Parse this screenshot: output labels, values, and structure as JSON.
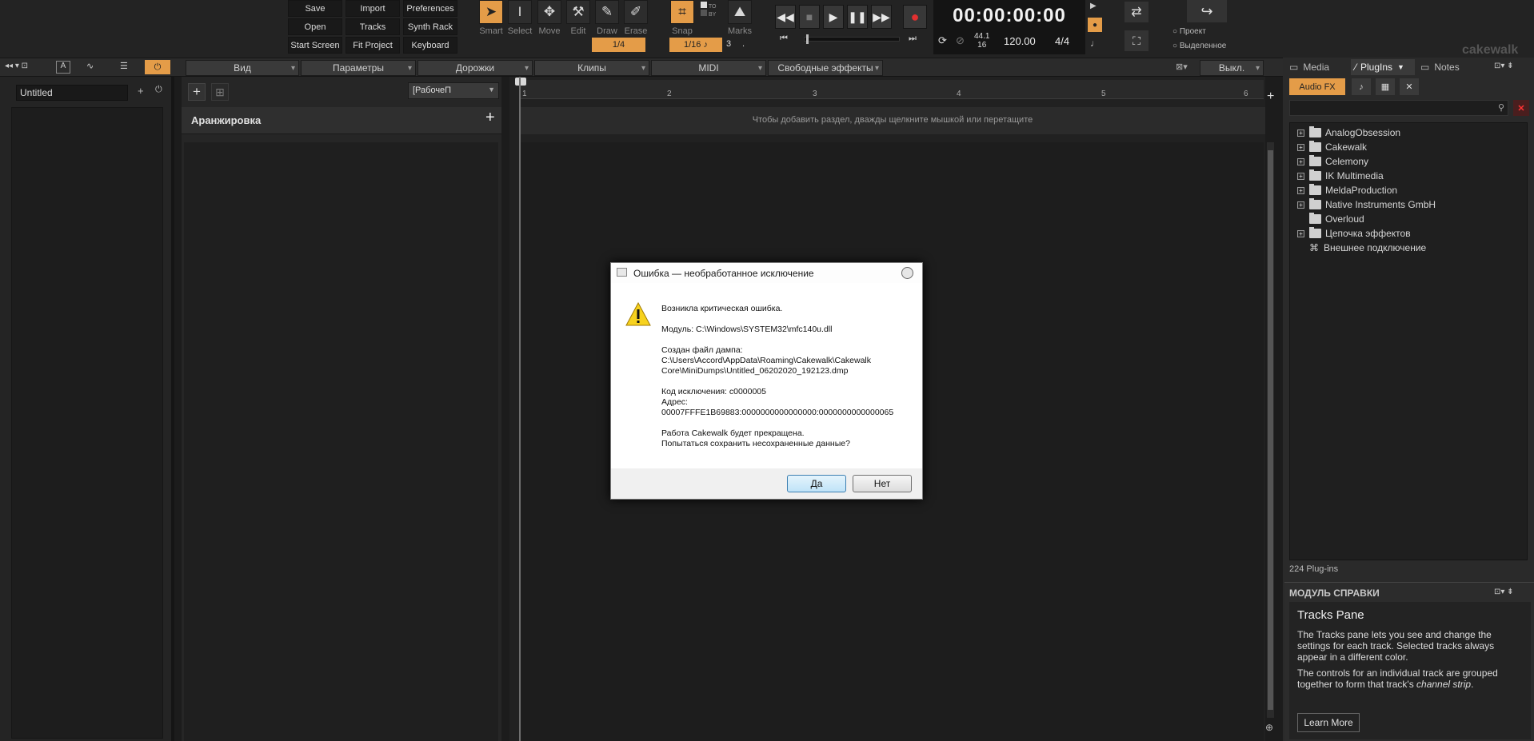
{
  "toolbar": {
    "file_buttons": [
      "Save",
      "Import",
      "Preferences",
      "Open",
      "Tracks",
      "Synth Rack",
      "Start Screen",
      "Fit Project",
      "Keyboard"
    ],
    "tools": [
      {
        "label": "Smart",
        "icon": "smart-arrow-icon"
      },
      {
        "label": "Select",
        "icon": "select-cursor-icon"
      },
      {
        "label": "Move",
        "icon": "move-arrows-icon"
      },
      {
        "label": "Edit",
        "icon": "edit-wrench-icon"
      },
      {
        "label": "Draw",
        "icon": "pencil-icon"
      },
      {
        "label": "Erase",
        "icon": "eraser-icon"
      }
    ],
    "snap_label": "Snap",
    "marks_label": "Marks",
    "to_label": "TO",
    "by_label": "BY",
    "snap_value_left": "1/4",
    "snap_value": "1/16",
    "snap_extra": "3",
    "snap_dot": ".",
    "time": "00:00:00:00",
    "sample_rate": "44.1",
    "bit_depth": "16",
    "tempo": "120.00",
    "meter": "4/4",
    "radio_project": "Проект",
    "radio_selection": "Выделенное",
    "logo": "cakewalk"
  },
  "menus": [
    "Вид",
    "Параметры",
    "Дорожки",
    "Клипы",
    "MIDI",
    "Свободные эффекты"
  ],
  "menu_right": "Выкл.",
  "left_panel": {
    "track_name": "Untitled"
  },
  "arranger": {
    "preset": "[РабочеП",
    "title": "Аранжировка"
  },
  "timeline": {
    "ruler_marks": [
      "1",
      "2",
      "3",
      "4",
      "5",
      "6"
    ],
    "section_hint": "Чтобы добавить раздел, дважды щелкните мышкой или перетащите"
  },
  "right_panel": {
    "tabs": [
      "Media",
      "PlugIns",
      "Notes"
    ],
    "category": "Audio FX",
    "tree": [
      {
        "label": "AnalogObsession",
        "expandable": true
      },
      {
        "label": "Cakewalk",
        "expandable": true
      },
      {
        "label": "Celemony",
        "expandable": true
      },
      {
        "label": "IK Multimedia",
        "expandable": true
      },
      {
        "label": "MeldaProduction",
        "expandable": true
      },
      {
        "label": "Native Instruments GmbH",
        "expandable": true
      },
      {
        "label": "Overloud",
        "expandable": false
      },
      {
        "label": "Цепочка эффектов",
        "expandable": true
      },
      {
        "label": "Внешнее подключение",
        "expandable": false
      }
    ],
    "count": "224 Plug-ins"
  },
  "help": {
    "header": "МОДУЛЬ СПРАВКИ",
    "title": "Tracks Pane",
    "p1": "The Tracks pane lets you see and change the settings for each track. Selected tracks always appear in a different color.",
    "p2_a": "The controls for an individual track are grouped together to form that track's ",
    "p2_em": "channel strip",
    "p2_b": ".",
    "button": "Learn More"
  },
  "dialog": {
    "title": "Ошибка — необработанное исключение",
    "line1": "Возникла критическая ошибка.",
    "line2": "Модуль: C:\\Windows\\SYSTEM32\\mfc140u.dll",
    "line3": "Создан файл дампа:",
    "line4": "C:\\Users\\Accord\\AppData\\Roaming\\Cakewalk\\Cakewalk",
    "line5": "Core\\MiniDumps\\Untitled_06202020_192123.dmp",
    "line6": "Код исключения: c0000005",
    "line7": "Адрес:",
    "line8": "00007FFFE1B69883:0000000000000000:0000000000000065",
    "line9": "Работа Cakewalk будет прекращена.",
    "line10": "Попытаться сохранить несохраненные данные?",
    "yes": "Да",
    "no": "Нет"
  }
}
